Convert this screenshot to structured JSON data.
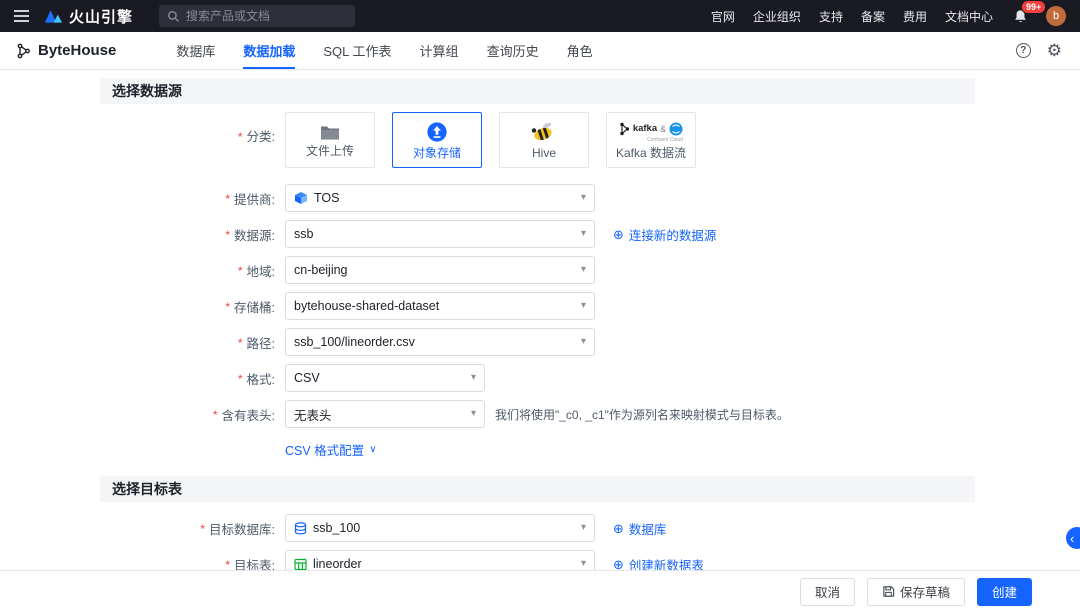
{
  "common": {
    "required": "*"
  },
  "icons": {
    "caret": "▾",
    "plus": "⊕",
    "help": "?",
    "gear": "⚙",
    "chevron_down": "∨",
    "chevron_left": "‹"
  },
  "topbar": {
    "brand": "火山引擎",
    "search_placeholder": "搜索产品或文档",
    "links": [
      "官网",
      "企业组织",
      "支持",
      "备案",
      "费用",
      "文档中心"
    ],
    "badge": "99+",
    "avatar": "b"
  },
  "nav": {
    "brand": "ByteHouse",
    "tabs": [
      "数据库",
      "数据加载",
      "SQL 工作表",
      "计算组",
      "查询历史",
      "角色"
    ],
    "active_tab": "数据加载"
  },
  "source": {
    "title": "选择数据源",
    "category": {
      "label": "分类:",
      "options": [
        {
          "label": "文件上传",
          "selected": false
        },
        {
          "label": "对象存储",
          "selected": true
        },
        {
          "label": "Hive",
          "selected": false
        },
        {
          "label": "Kafka 数据流",
          "selected": false,
          "kafka_text": "kafka",
          "amp": "&",
          "caption": "Confluent Cloud"
        }
      ]
    },
    "fields": {
      "provider": {
        "label": "提供商:",
        "value": "TOS"
      },
      "datasource": {
        "label": "数据源:",
        "value": "ssb",
        "link": "连接新的数据源"
      },
      "region": {
        "label": "地域:",
        "value": "cn-beijing"
      },
      "bucket": {
        "label": "存储桶:",
        "value": "bytehouse-shared-dataset"
      },
      "path": {
        "label": "路径:",
        "value": "ssb_100/lineorder.csv"
      },
      "format": {
        "label": "格式:",
        "value": "CSV"
      },
      "header": {
        "label": "含有表头:",
        "value": "无表头",
        "hint": "我们将使用\"_c0, _c1\"作为源列名来映射模式与目标表。"
      }
    },
    "csv_config_link": "CSV 格式配置"
  },
  "target": {
    "title": "选择目标表",
    "fields": {
      "database": {
        "label": "目标数据库:",
        "value": "ssb_100",
        "link": "数据库"
      },
      "table": {
        "label": "目标表:",
        "value": "lineorder",
        "link": "创建新数据表"
      }
    }
  },
  "footer": {
    "cancel": "取消",
    "save_draft": "保存草稿",
    "create": "创建"
  },
  "colors": {
    "primary": "#1664ff",
    "danger": "#f53f3f",
    "topbar_bg": "#191a22"
  }
}
